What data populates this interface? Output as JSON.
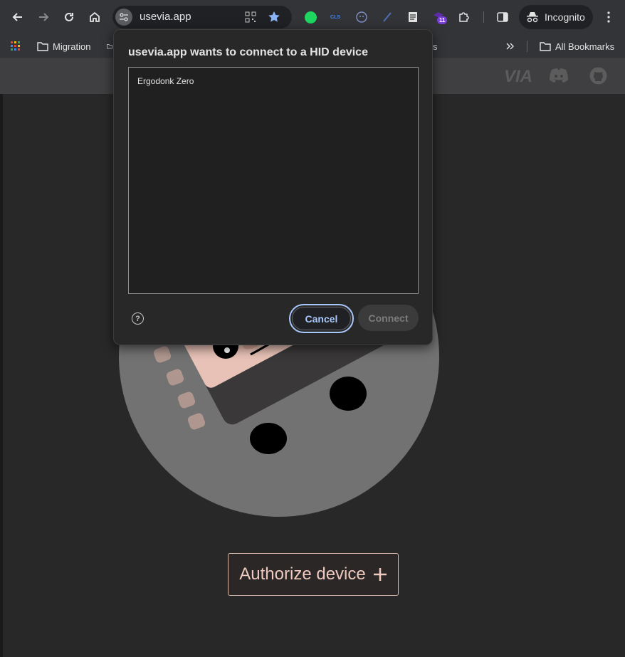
{
  "browser": {
    "url": "usevia.app",
    "incognito_label": "Incognito",
    "extension_badge": "11",
    "bookmarks": [
      {
        "label": "Migration"
      },
      {
        "label": "s"
      },
      {
        "label": "All Bookmarks"
      }
    ]
  },
  "dialog": {
    "title": "usevia.app wants to connect to a HID device",
    "devices": [
      "Ergodonk Zero"
    ],
    "cancel_label": "Cancel",
    "connect_label": "Connect"
  },
  "header": {
    "logo_text": "VIA"
  },
  "main": {
    "authorize_label": "Authorize device"
  },
  "colors": {
    "accent": "#a8c7fa",
    "authorize_text": "#efc9bd",
    "extension_green": "#1ed760",
    "extension_badge_bg": "#7b3fd9"
  },
  "icons": [
    "back-icon",
    "forward-icon",
    "reload-icon",
    "home-icon",
    "site-settings-icon",
    "qr-code-icon",
    "star-icon",
    "extensions-icon",
    "side-panel-icon",
    "incognito-icon",
    "more-icon",
    "apps-icon",
    "folder-icon",
    "chevron-double-right-icon",
    "discord-icon",
    "github-icon",
    "help-icon",
    "plus-icon"
  ]
}
